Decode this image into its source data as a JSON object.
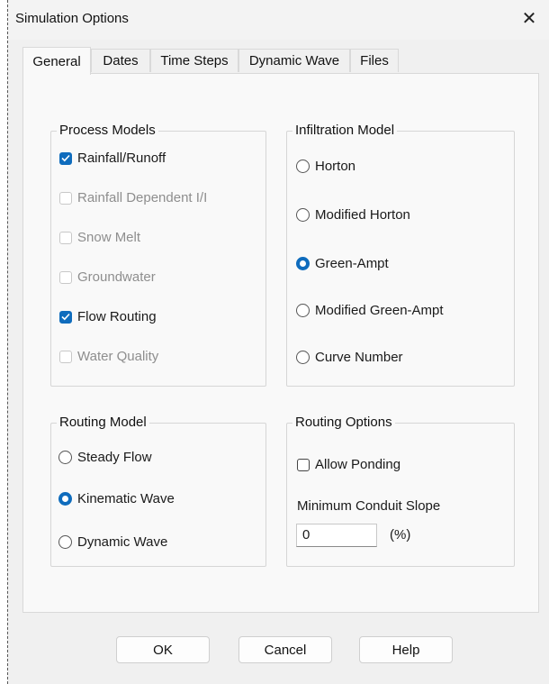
{
  "window": {
    "title": "Simulation Options",
    "close_label": "✕"
  },
  "tabs": [
    {
      "label": "General",
      "active": true
    },
    {
      "label": "Dates",
      "active": false
    },
    {
      "label": "Time Steps",
      "active": false
    },
    {
      "label": "Dynamic Wave",
      "active": false
    },
    {
      "label": "Files",
      "active": false
    }
  ],
  "process_models": {
    "label": "Process Models",
    "items": [
      {
        "label": "Rainfall/Runoff",
        "checked": true,
        "enabled": true
      },
      {
        "label": "Rainfall Dependent I/I",
        "checked": false,
        "enabled": false
      },
      {
        "label": "Snow Melt",
        "checked": false,
        "enabled": false
      },
      {
        "label": "Groundwater",
        "checked": false,
        "enabled": false
      },
      {
        "label": "Flow Routing",
        "checked": true,
        "enabled": true
      },
      {
        "label": "Water Quality",
        "checked": false,
        "enabled": false
      }
    ]
  },
  "infiltration_model": {
    "label": "Infiltration Model",
    "items": [
      {
        "label": "Horton",
        "selected": false
      },
      {
        "label": "Modified Horton",
        "selected": false
      },
      {
        "label": "Green-Ampt",
        "selected": true
      },
      {
        "label": "Modified Green-Ampt",
        "selected": false
      },
      {
        "label": "Curve Number",
        "selected": false
      }
    ]
  },
  "routing_model": {
    "label": "Routing Model",
    "items": [
      {
        "label": "Steady Flow",
        "selected": false
      },
      {
        "label": "Kinematic Wave",
        "selected": true
      },
      {
        "label": "Dynamic Wave",
        "selected": false
      }
    ]
  },
  "routing_options": {
    "label": "Routing Options",
    "allow_ponding": {
      "label": "Allow Ponding",
      "checked": false
    },
    "min_slope_label": "Minimum Conduit Slope",
    "min_slope_value": "0",
    "min_slope_unit": "(%)"
  },
  "buttons": {
    "ok": "OK",
    "cancel": "Cancel",
    "help": "Help"
  },
  "colors": {
    "accent": "#0f6cbd",
    "dialog_bg": "#f0f0f0",
    "panel_bg": "#f9f9f9"
  }
}
